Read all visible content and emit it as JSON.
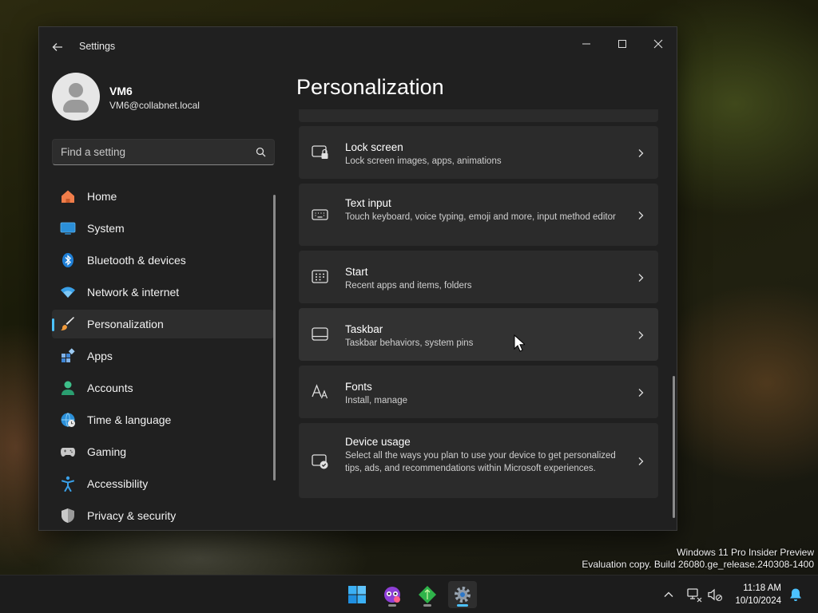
{
  "window": {
    "title": "Settings"
  },
  "profile": {
    "name": "VM6",
    "email": "VM6@collabnet.local"
  },
  "search": {
    "placeholder": "Find a setting",
    "value": ""
  },
  "sidebar": {
    "items": [
      {
        "label": "Home",
        "icon": "home-icon",
        "active": false
      },
      {
        "label": "System",
        "icon": "system-icon",
        "active": false
      },
      {
        "label": "Bluetooth & devices",
        "icon": "bluetooth-icon",
        "active": false
      },
      {
        "label": "Network & internet",
        "icon": "network-icon",
        "active": false
      },
      {
        "label": "Personalization",
        "icon": "brush-icon",
        "active": true
      },
      {
        "label": "Apps",
        "icon": "apps-icon",
        "active": false
      },
      {
        "label": "Accounts",
        "icon": "accounts-icon",
        "active": false
      },
      {
        "label": "Time & language",
        "icon": "globe-clock-icon",
        "active": false
      },
      {
        "label": "Gaming",
        "icon": "gamepad-icon",
        "active": false
      },
      {
        "label": "Accessibility",
        "icon": "accessibility-icon",
        "active": false
      },
      {
        "label": "Privacy & security",
        "icon": "shield-icon",
        "active": false
      }
    ]
  },
  "main": {
    "title": "Personalization",
    "cards": [
      {
        "title": "Lock screen",
        "desc": "Lock screen images, apps, animations",
        "icon": "lock-screen-icon"
      },
      {
        "title": "Text input",
        "desc": "Touch keyboard, voice typing, emoji and more, input method editor",
        "icon": "keyboard-icon"
      },
      {
        "title": "Start",
        "desc": "Recent apps and items, folders",
        "icon": "start-icon"
      },
      {
        "title": "Taskbar",
        "desc": "Taskbar behaviors, system pins",
        "icon": "taskbar-icon"
      },
      {
        "title": "Fonts",
        "desc": "Install, manage",
        "icon": "fonts-icon"
      },
      {
        "title": "Device usage",
        "desc": "Select all the ways you plan to use your device to get personalized tips, ads, and recommendations within Microsoft experiences.",
        "icon": "device-usage-icon"
      }
    ]
  },
  "watermark": {
    "line1": "Windows 11 Pro Insider Preview",
    "line2": "Evaluation copy. Build 26080.ge_release.240308-1400"
  },
  "taskbar": {
    "apps": [
      "windows-start-icon",
      "copilot-icon",
      "app-green-icon",
      "settings-gear-icon"
    ],
    "time": "11:18 AM",
    "date": "10/10/2024"
  },
  "colors": {
    "accent": "#4cc2ff",
    "window_bg": "#202020",
    "card_bg": "#2b2b2b"
  }
}
